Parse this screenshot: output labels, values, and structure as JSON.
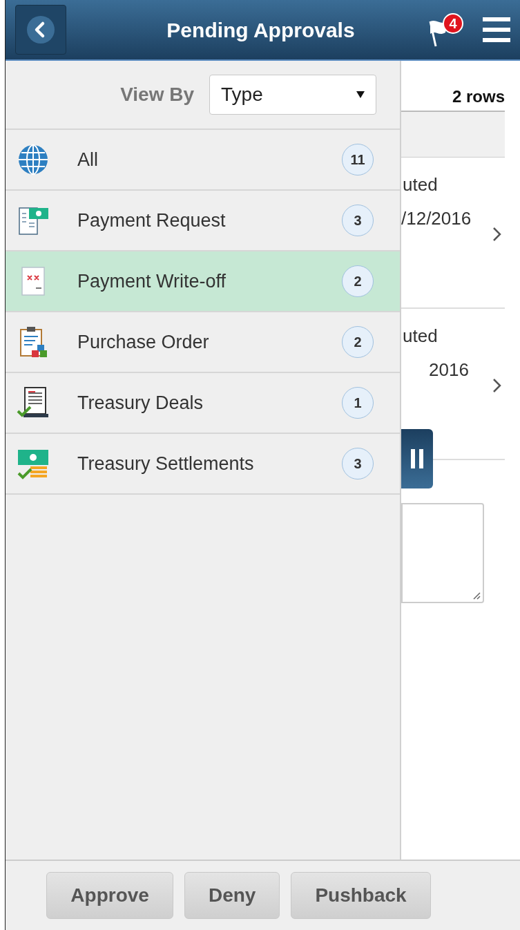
{
  "header": {
    "title": "Pending Approvals",
    "notification_count": "4"
  },
  "filter": {
    "label": "View By",
    "value": "Type"
  },
  "categories": [
    {
      "label": "All",
      "count": "11",
      "selected": false
    },
    {
      "label": "Payment Request",
      "count": "3",
      "selected": false
    },
    {
      "label": "Payment Write-off",
      "count": "2",
      "selected": true
    },
    {
      "label": "Purchase Order",
      "count": "2",
      "selected": false
    },
    {
      "label": "Treasury Deals",
      "count": "1",
      "selected": false
    },
    {
      "label": "Treasury Settlements",
      "count": "3",
      "selected": false
    }
  ],
  "list": {
    "row_count": "2 rows",
    "rows": [
      {
        "column_1": "uted",
        "column_2": "/12/2016"
      },
      {
        "column_1": "uted",
        "column_2": "2016"
      }
    ]
  },
  "actions": [
    "Approve",
    "Deny",
    "Pushback"
  ]
}
